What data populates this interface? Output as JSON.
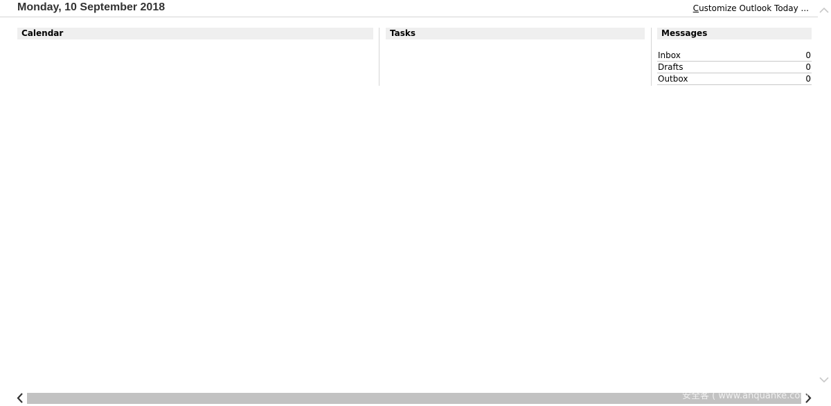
{
  "header": {
    "date": "Monday, 10 September 2018",
    "customize_prefix": "",
    "customize_underlined": "C",
    "customize_rest": "ustomize Outlook Today ..."
  },
  "columns": {
    "calendar": {
      "title": "Calendar"
    },
    "tasks": {
      "title": "Tasks"
    },
    "messages": {
      "title": "Messages",
      "items": [
        {
          "label": "Inbox",
          "count": "0"
        },
        {
          "label": "Drafts",
          "count": "0"
        },
        {
          "label": "Outbox",
          "count": "0"
        }
      ]
    }
  },
  "icons": {
    "scroll_up": "chevron-up-icon",
    "scroll_down": "chevron-down-icon",
    "scroll_left": "chevron-left-icon",
    "scroll_right": "chevron-right-icon"
  },
  "watermark": "安全客 ( www.anquanke.com )",
  "colors": {
    "header_bg": "#efefef",
    "divider": "#d4d4d4",
    "scroll_thumb": "#c2c2c2",
    "title_text": "#333333"
  }
}
